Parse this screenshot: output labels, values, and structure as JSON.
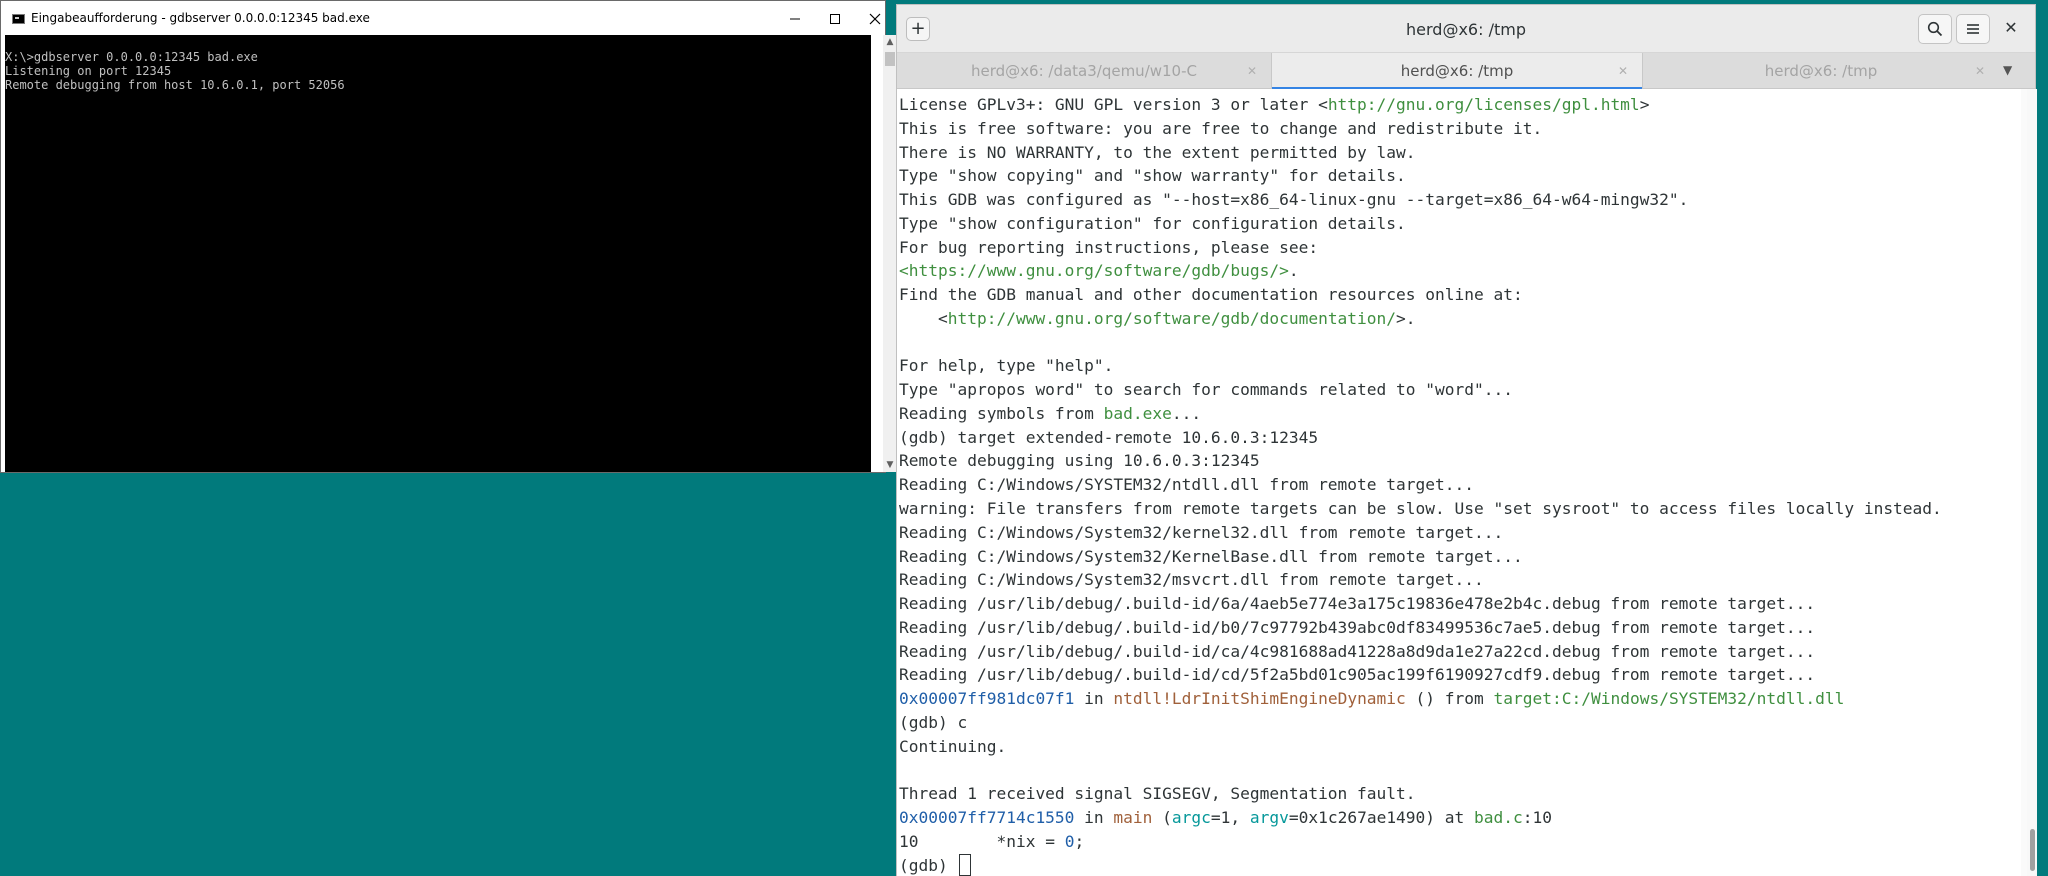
{
  "cmd": {
    "title": "Eingabeaufforderung - gdbserver  0.0.0.0:12345 bad.exe",
    "lines": [
      "X:\\>gdbserver 0.0.0.0:12345 bad.exe",
      "Listening on port 12345",
      "Remote debugging from host 10.6.0.1, port 52056"
    ],
    "icon": "console-icon"
  },
  "terminal": {
    "title": "herd@x6: /tmp",
    "tabs": [
      {
        "label": "herd@x6: /data3/qemu/w10-C",
        "active": false
      },
      {
        "label": "herd@x6: /tmp",
        "active": true
      },
      {
        "label": "herd@x6: /tmp",
        "active": false
      }
    ],
    "lines": [
      [
        {
          "t": "License GPLv3+: GNU GPL version 3 or later <"
        },
        {
          "t": "http://gnu.org/licenses/gpl.html",
          "c": "c-green2"
        },
        {
          "t": ">"
        }
      ],
      [
        {
          "t": "This is free software: you are free to change and redistribute it."
        }
      ],
      [
        {
          "t": "There is NO WARRANTY, to the extent permitted by law."
        }
      ],
      [
        {
          "t": "Type \"show copying\" and \"show warranty\" for details."
        }
      ],
      [
        {
          "t": "This GDB was configured as \"--host=x86_64-linux-gnu --target=x86_64-w64-mingw32\"."
        }
      ],
      [
        {
          "t": "Type \"show configuration\" for configuration details."
        }
      ],
      [
        {
          "t": "For bug reporting instructions, please see:"
        }
      ],
      [
        {
          "t": "<https://www.gnu.org/software/gdb/bugs/>",
          "c": "c-green2"
        },
        {
          "t": "."
        }
      ],
      [
        {
          "t": "Find the GDB manual and other documentation resources online at:"
        }
      ],
      [
        {
          "t": "    <"
        },
        {
          "t": "http://www.gnu.org/software/gdb/documentation/",
          "c": "c-green2"
        },
        {
          "t": ">."
        }
      ],
      [
        {
          "t": ""
        }
      ],
      [
        {
          "t": "For help, type \"help\"."
        }
      ],
      [
        {
          "t": "Type \"apropos word\" to search for commands related to \"word\"..."
        }
      ],
      [
        {
          "t": "Reading symbols from "
        },
        {
          "t": "bad.exe",
          "c": "c-green2"
        },
        {
          "t": "..."
        }
      ],
      [
        {
          "t": "(gdb) target extended-remote 10.6.0.3:12345"
        }
      ],
      [
        {
          "t": "Remote debugging using 10.6.0.3:12345"
        }
      ],
      [
        {
          "t": "Reading C:/Windows/SYSTEM32/ntdll.dll from remote target..."
        }
      ],
      [
        {
          "t": "warning: File transfers from remote targets can be slow. Use \"set sysroot\" to access files locally instead."
        }
      ],
      [
        {
          "t": "Reading C:/Windows/System32/kernel32.dll from remote target..."
        }
      ],
      [
        {
          "t": "Reading C:/Windows/System32/KernelBase.dll from remote target..."
        }
      ],
      [
        {
          "t": "Reading C:/Windows/System32/msvcrt.dll from remote target..."
        }
      ],
      [
        {
          "t": "Reading /usr/lib/debug/.build-id/6a/4aeb5e774e3a175c19836e478e2b4c.debug from remote target..."
        }
      ],
      [
        {
          "t": "Reading /usr/lib/debug/.build-id/b0/7c97792b439abc0df83499536c7ae5.debug from remote target..."
        }
      ],
      [
        {
          "t": "Reading /usr/lib/debug/.build-id/ca/4c981688ad41228a8d9da1e27a22cd.debug from remote target..."
        }
      ],
      [
        {
          "t": "Reading /usr/lib/debug/.build-id/cd/5f2a5bd01c905ac199f6190927cdf9.debug from remote target..."
        }
      ],
      [
        {
          "t": "0x00007ff981dc07f1",
          "c": "c-blue"
        },
        {
          "t": " in "
        },
        {
          "t": "ntdll!LdrInitShimEngineDynamic",
          "c": "c-brown"
        },
        {
          "t": " () from "
        },
        {
          "t": "target:C:/Windows/SYSTEM32/ntdll.dll",
          "c": "c-green2"
        }
      ],
      [
        {
          "t": "(gdb) c"
        }
      ],
      [
        {
          "t": "Continuing."
        }
      ],
      [
        {
          "t": ""
        }
      ],
      [
        {
          "t": "Thread 1 received signal SIGSEGV, Segmentation fault."
        }
      ],
      [
        {
          "t": "0x00007ff7714c1550",
          "c": "c-blue"
        },
        {
          "t": " in "
        },
        {
          "t": "main",
          "c": "c-brown"
        },
        {
          "t": " ("
        },
        {
          "t": "argc",
          "c": "c-teal"
        },
        {
          "t": "=1, "
        },
        {
          "t": "argv",
          "c": "c-teal"
        },
        {
          "t": "=0x1c267ae1490) at "
        },
        {
          "t": "bad.c",
          "c": "c-green2"
        },
        {
          "t": ":10"
        }
      ],
      [
        {
          "t": "10\t  *nix = "
        },
        {
          "t": "0",
          "c": "c-blue"
        },
        {
          "t": ";"
        }
      ],
      [
        {
          "t": "(gdb) "
        }
      ]
    ]
  }
}
